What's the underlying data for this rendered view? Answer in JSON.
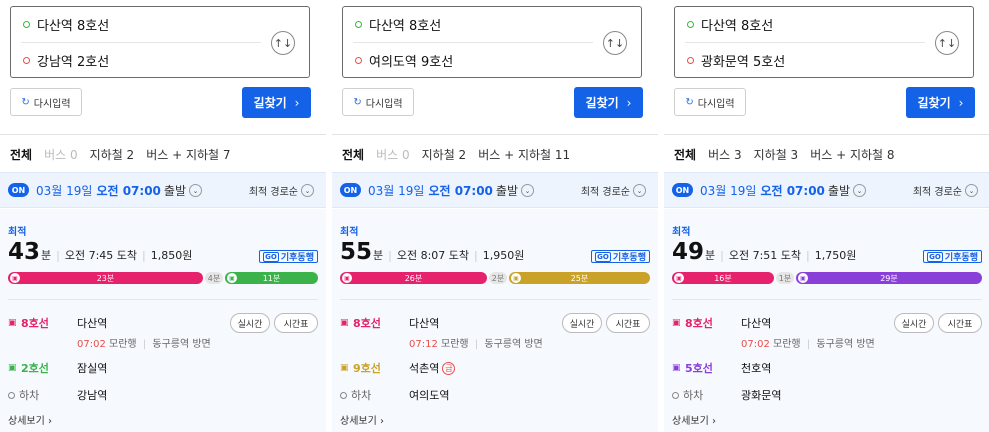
{
  "panels": [
    {
      "from": "다산역 8호선",
      "to": "강남역 2호선",
      "reset_label": "다시입력",
      "search_label": "길찾기",
      "tabs": [
        {
          "label": "전체",
          "state": "active"
        },
        {
          "label": "버스 0",
          "state": "disabled"
        },
        {
          "label": "지하철 2",
          "state": "normal"
        },
        {
          "label": "버스 + 지하철 7",
          "state": "normal"
        }
      ],
      "on_badge": "ON",
      "departure_date": "03월 19일",
      "departure_time": "오전 07:00",
      "departure_suffix": "출발",
      "sort_label": "최적 경로순",
      "best_label": "최적",
      "total_minutes": "43",
      "minute_unit": "분",
      "arrival": "오전 7:45 도착",
      "fare": "1,850원",
      "wait_tag": "기후동행",
      "wait_tag_icon": "GO",
      "timeline": [
        {
          "kind": "ride",
          "label": "23분",
          "minutes": 23,
          "color": "#e5226b"
        },
        {
          "kind": "walk",
          "label": "4분",
          "minutes": 4
        },
        {
          "kind": "ride",
          "label": "11분",
          "minutes": 11,
          "color": "#3bb34a"
        }
      ],
      "steps": [
        {
          "line": "8호선",
          "color": "#e5226b",
          "station": "다산역",
          "time": "07:02",
          "direction1": "모란행",
          "direction2": "동구릉역 방면",
          "express": ""
        },
        {
          "line": "2호선",
          "color": "#3bb34a",
          "station": "잠실역",
          "express": ""
        }
      ],
      "exit_label": "하차",
      "exit_station": "강남역",
      "realtime_label": "실시간",
      "timetable_label": "시간표",
      "detail_label": "상세보기"
    },
    {
      "from": "다산역 8호선",
      "to": "여의도역 9호선",
      "reset_label": "다시입력",
      "search_label": "길찾기",
      "tabs": [
        {
          "label": "전체",
          "state": "active"
        },
        {
          "label": "버스 0",
          "state": "disabled"
        },
        {
          "label": "지하철 2",
          "state": "normal"
        },
        {
          "label": "버스 + 지하철 11",
          "state": "normal"
        }
      ],
      "on_badge": "ON",
      "departure_date": "03월 19일",
      "departure_time": "오전 07:00",
      "departure_suffix": "출발",
      "sort_label": "최적 경로순",
      "best_label": "최적",
      "total_minutes": "55",
      "minute_unit": "분",
      "arrival": "오전 8:07 도착",
      "fare": "1,950원",
      "wait_tag": "기후동행",
      "wait_tag_icon": "GO",
      "timeline": [
        {
          "kind": "ride",
          "label": "26분",
          "minutes": 26,
          "color": "#e5226b"
        },
        {
          "kind": "walk",
          "label": "2분",
          "minutes": 2
        },
        {
          "kind": "ride",
          "label": "25분",
          "minutes": 25,
          "color": "#c9a227"
        }
      ],
      "steps": [
        {
          "line": "8호선",
          "color": "#e5226b",
          "station": "다산역",
          "time": "07:12",
          "direction1": "모란행",
          "direction2": "동구릉역 방면",
          "express": ""
        },
        {
          "line": "9호선",
          "color": "#c9a227",
          "station": "석촌역",
          "express": "급"
        }
      ],
      "exit_label": "하차",
      "exit_station": "여의도역",
      "realtime_label": "실시간",
      "timetable_label": "시간표",
      "detail_label": "상세보기"
    },
    {
      "from": "다산역 8호선",
      "to": "광화문역 5호선",
      "reset_label": "다시입력",
      "search_label": "길찾기",
      "tabs": [
        {
          "label": "전체",
          "state": "active"
        },
        {
          "label": "버스 3",
          "state": "normal"
        },
        {
          "label": "지하철 3",
          "state": "normal"
        },
        {
          "label": "버스 + 지하철 8",
          "state": "normal"
        }
      ],
      "on_badge": "ON",
      "departure_date": "03월 19일",
      "departure_time": "오전 07:00",
      "departure_suffix": "출발",
      "sort_label": "최적 경로순",
      "best_label": "최적",
      "total_minutes": "49",
      "minute_unit": "분",
      "arrival": "오전 7:51 도착",
      "fare": "1,750원",
      "wait_tag": "기후동행",
      "wait_tag_icon": "GO",
      "timeline": [
        {
          "kind": "ride",
          "label": "16분",
          "minutes": 16,
          "color": "#e5226b"
        },
        {
          "kind": "walk",
          "label": "1분",
          "minutes": 1
        },
        {
          "kind": "ride",
          "label": "29분",
          "minutes": 29,
          "color": "#8b3fd9"
        }
      ],
      "steps": [
        {
          "line": "8호선",
          "color": "#e5226b",
          "station": "다산역",
          "time": "07:02",
          "direction1": "모란행",
          "direction2": "동구릉역 방면",
          "express": ""
        },
        {
          "line": "5호선",
          "color": "#8b3fd9",
          "station": "천호역",
          "express": ""
        }
      ],
      "exit_label": "하차",
      "exit_station": "광화문역",
      "realtime_label": "실시간",
      "timetable_label": "시간표",
      "detail_label": "상세보기"
    }
  ],
  "colors": {
    "accent": "#1462e8",
    "time_red": "#e8504b"
  },
  "icons": {
    "swap": "swap-vertical-icon",
    "reset": "refresh-icon",
    "subway": "subway-icon",
    "chevron": "chevron-down-icon"
  }
}
